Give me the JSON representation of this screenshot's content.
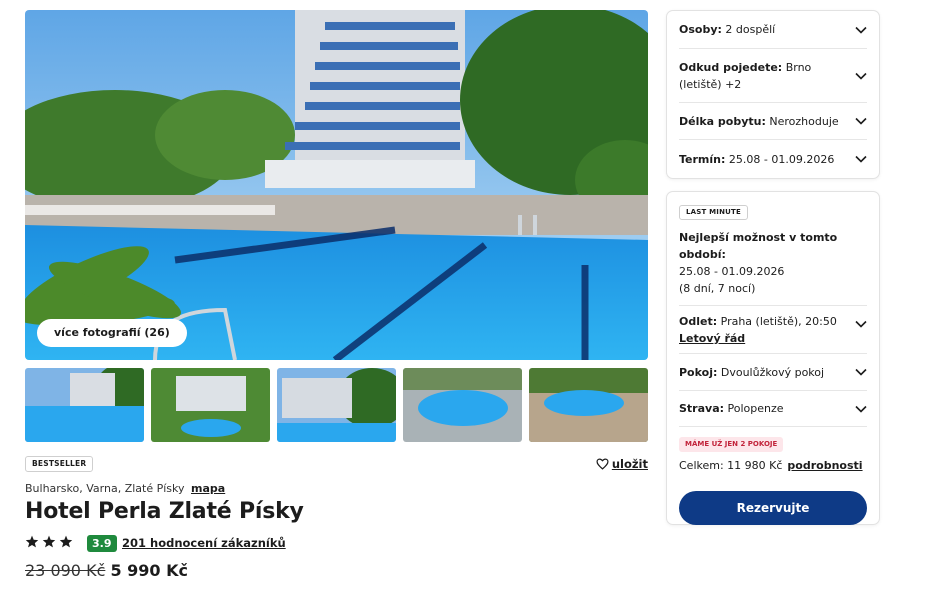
{
  "gallery": {
    "more_photos_label": "více fotografií (26)",
    "thumbnail_count": 5
  },
  "hotel": {
    "badge": "BESTSELLER",
    "save_label": "uložit",
    "location": "Bulharsko, Varna, Zlaté Písky",
    "map_label": "mapa",
    "name": "Hotel Perla Zlaté Písky",
    "stars": 3,
    "rating": "3.9",
    "reviews_label": "201 hodnocení zákazníků",
    "price_old": "23 090 Kč",
    "price_new": "5 990 Kč"
  },
  "filters": {
    "persons_label": "Osoby:",
    "persons_value": "2 dospělí",
    "departure_label": "Odkud pojedete:",
    "departure_value": "Brno (letiště) +2",
    "length_label": "Délka pobytu:",
    "length_value": "Nerozhoduje",
    "term_label": "Termín:",
    "term_value": "25.08 - 01.09.2026"
  },
  "offer": {
    "badge": "LAST MINUTE",
    "best_title": "Nejlepší možnost v tomto období:",
    "dates": "25.08 - 01.09.2026",
    "nights": "(8 dní, 7 nocí)",
    "departure_label": "Odlet:",
    "departure_value": "Praha (letiště), 20:50",
    "schedule_link": "Letový řád",
    "room_label": "Pokoj:",
    "room_value": "Dvoulůžkový pokoj",
    "board_label": "Strava:",
    "board_value": "Polopenze",
    "availability": "MÁME UŽ JEN 2 POKOJE",
    "total_label": "Celkem: 11 980 Kč",
    "details_link": "podrobnosti",
    "cta_label": "Rezervujte"
  },
  "colors": {
    "accent_button": "#0e3a86",
    "rating_bg": "#1f8a3d",
    "warning_text": "#c2243b",
    "warning_bg": "#fde6ea"
  }
}
